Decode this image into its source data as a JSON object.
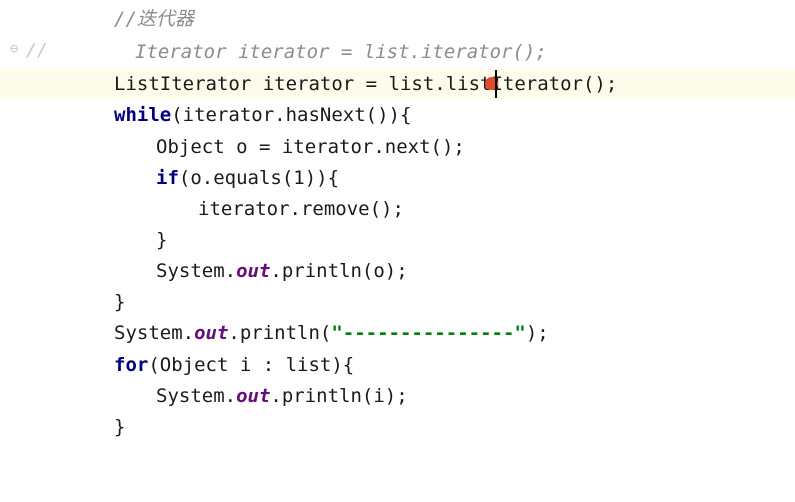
{
  "gutter": {
    "fold_glyph": "⊖",
    "comment_prefix": "//"
  },
  "colors": {
    "keyword": "#000080",
    "static_field": "#660e7a",
    "string": "#067d17",
    "comment": "#8c8c8c",
    "current_line": "#fdfbe9",
    "cursor_marker": "#e34b2b"
  },
  "code_lines": [
    {
      "text": "//迭代器"
    },
    {
      "text": "Iterator iterator = list.iterator();"
    },
    {
      "text": "ListIterator iterator = list.listIterator();"
    },
    {
      "kw": "while",
      "rest": "(iterator.hasNext()){"
    },
    {
      "text": "Object o = iterator.next();"
    },
    {
      "kw": "if",
      "rest": "(o.equals(1)){"
    },
    {
      "text": "iterator.remove();"
    },
    {
      "text": "}"
    },
    {
      "pre": "System.",
      "field": "out",
      "post": ".println(o);"
    },
    {
      "text": "}"
    },
    {
      "pre": "System.",
      "field": "out",
      "post": ".println(",
      "str": "\"---------------\"",
      "end": ");"
    },
    {
      "kw": "for",
      "rest": "(Object i : list){"
    },
    {
      "pre": "System.",
      "field": "out",
      "post": ".println(i);"
    },
    {
      "text": "}"
    }
  ]
}
